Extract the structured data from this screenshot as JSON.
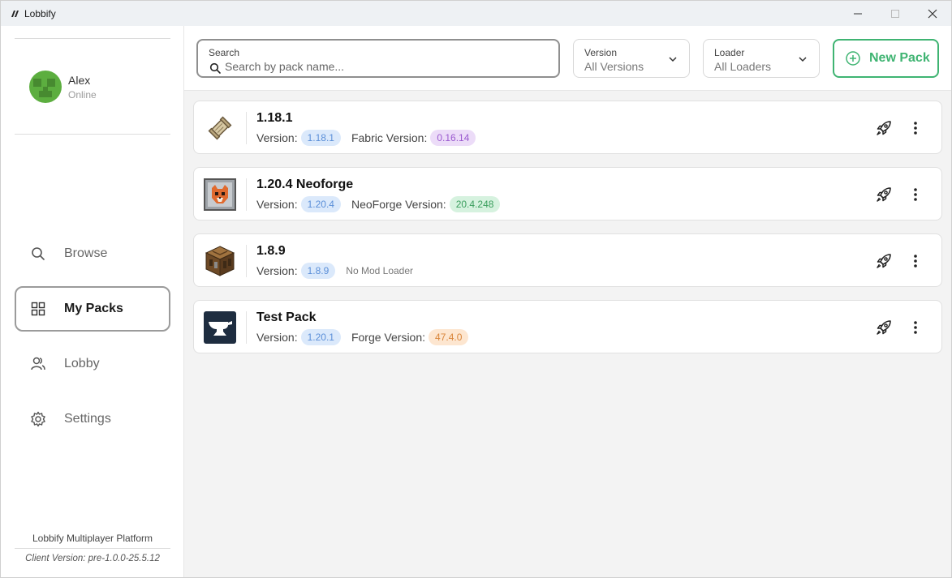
{
  "app": {
    "title": "Lobbify",
    "brand_color": "#3fb472"
  },
  "window_controls": {
    "icons": [
      "minimize-icon",
      "maximize-icon",
      "close-icon"
    ]
  },
  "profile": {
    "name": "Alex",
    "status": "Online",
    "avatar_color": "#5cae3f"
  },
  "nav": {
    "items": [
      {
        "label": "Browse",
        "icon": "search-icon",
        "active": false
      },
      {
        "label": "My Packs",
        "icon": "grid-icon",
        "active": true
      },
      {
        "label": "Lobby",
        "icon": "users-icon",
        "active": false
      },
      {
        "label": "Settings",
        "icon": "gear-icon",
        "active": false
      }
    ]
  },
  "footer": {
    "platform": "Lobbify Multiplayer Platform",
    "client_version": "Client Version: pre-1.0.0-25.5.12"
  },
  "toolbar": {
    "search_label": "Search",
    "search_placeholder": "Search by pack name...",
    "version_label": "Version",
    "version_value": "All Versions",
    "loader_label": "Loader",
    "loader_value": "All Loaders",
    "new_pack_label": "New Pack"
  },
  "packs": [
    {
      "name": "1.18.1",
      "version_label": "Version:",
      "version": "1.18.1",
      "loader_label": "Fabric Version:",
      "loader_version": "0.16.14",
      "loader_color": "purple",
      "icon": "scroll-icon"
    },
    {
      "name": "1.20.4 Neoforge",
      "version_label": "Version:",
      "version": "1.20.4",
      "loader_label": "NeoForge Version:",
      "loader_version": "20.4.248",
      "loader_color": "green",
      "icon": "fox-icon"
    },
    {
      "name": "1.8.9",
      "version_label": "Version:",
      "version": "1.8.9",
      "no_loader": "No Mod Loader",
      "icon": "crafting-table-icon"
    },
    {
      "name": "Test Pack",
      "version_label": "Version:",
      "version": "1.20.1",
      "loader_label": "Forge Version:",
      "loader_version": "47.4.0",
      "loader_color": "orange",
      "icon": "anvil-icon"
    }
  ]
}
